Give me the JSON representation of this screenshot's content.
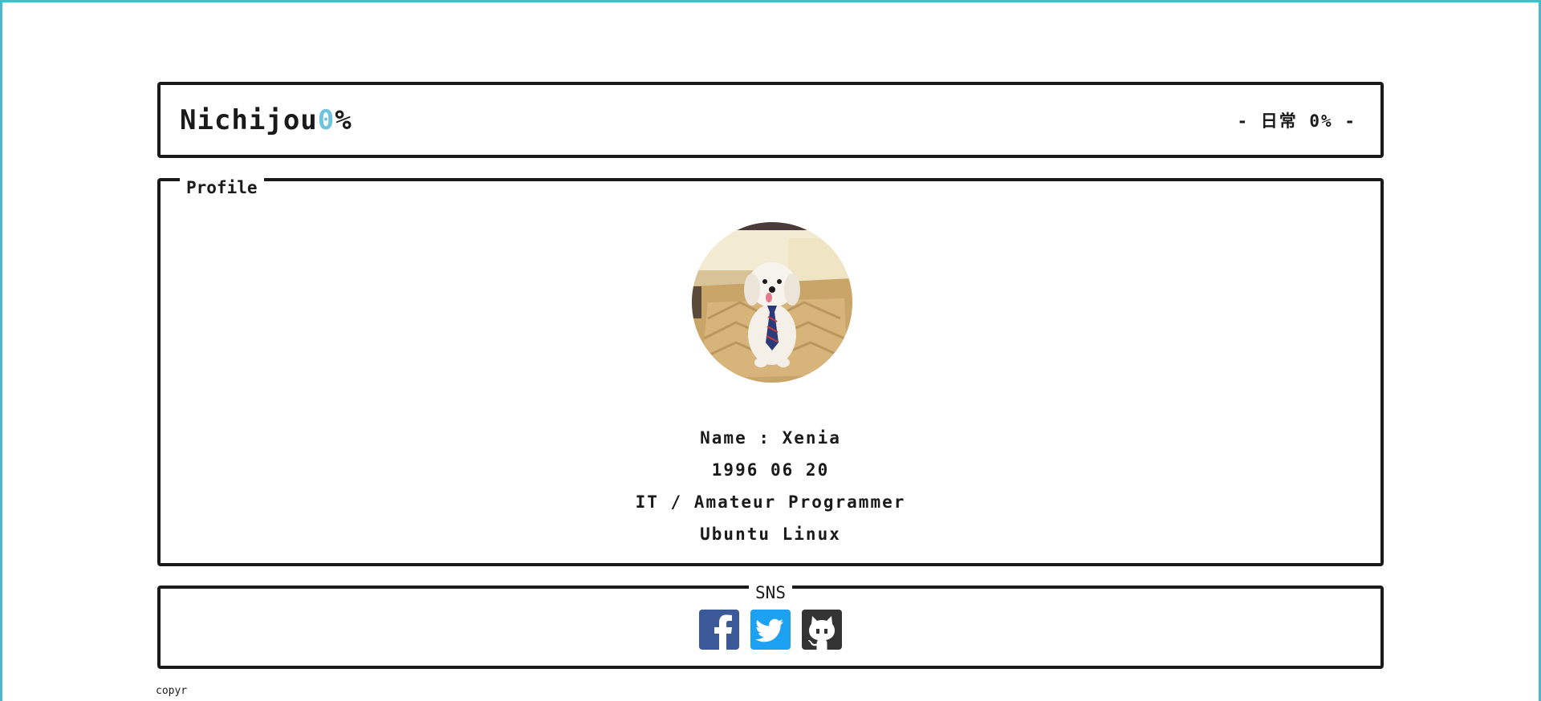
{
  "header": {
    "logo_main": "Nichijou",
    "logo_accent": "0",
    "logo_suffix": "%",
    "tagline": "- 日常 0% -"
  },
  "profile": {
    "legend": "Profile",
    "avatar_icon": "dog-photo",
    "name": "Name : Xenia",
    "birthday": "1996 06 20",
    "occupation": "IT / Amateur Programmer",
    "os": "Ubuntu Linux"
  },
  "sns": {
    "legend": "SNS",
    "links": [
      {
        "icon": "facebook-icon",
        "color": "#3b5998"
      },
      {
        "icon": "twitter-icon",
        "color": "#1da1f2"
      },
      {
        "icon": "github-icon",
        "color": "#333333"
      }
    ]
  },
  "footer": {
    "copyright": "copyr"
  },
  "colors": {
    "accent": "#6ec4de",
    "frame": "#4fb7cc",
    "border": "#1a1a1a"
  }
}
